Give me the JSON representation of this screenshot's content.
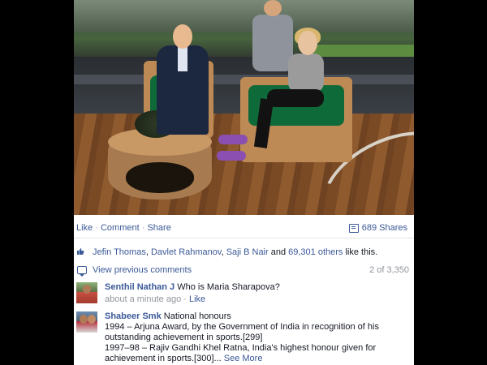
{
  "actions": {
    "like": "Like",
    "comment": "Comment",
    "share": "Share",
    "sep1": "·",
    "sep2": "·",
    "shares_count": "689 Shares"
  },
  "likes": {
    "name1": "Jefin Thomas",
    "name2": "Davlet Rahmanov",
    "name3": "Saji B Nair",
    "conj": " and ",
    "others": "69,301 others",
    "suffix": " like this."
  },
  "comments_nav": {
    "view_previous": "View previous comments",
    "count": "2 of 3,350"
  },
  "comments": [
    {
      "author": "Senthil Nathan J",
      "text": "Who is Maria Sharapova?",
      "time": "about a minute ago",
      "sep": " · ",
      "like": "Like"
    },
    {
      "author": "Shabeer Smk",
      "line1": "National honours",
      "line2": "1994 – Arjuna Award, by the Government of India in recognition of his outstanding achievement in sports.[299]",
      "line3": "1997–98 – Rajiv Gandhi Khel Ratna, India's highest honour given for achievement in sports.[300]...",
      "see_more": "See More"
    }
  ],
  "colors": {
    "link": "#3b5998",
    "muted": "#90949c",
    "text": "#141823"
  },
  "icons": {
    "shares": "shares-icon",
    "like": "thumbs-up-icon",
    "comment": "comment-bubble-icon"
  }
}
